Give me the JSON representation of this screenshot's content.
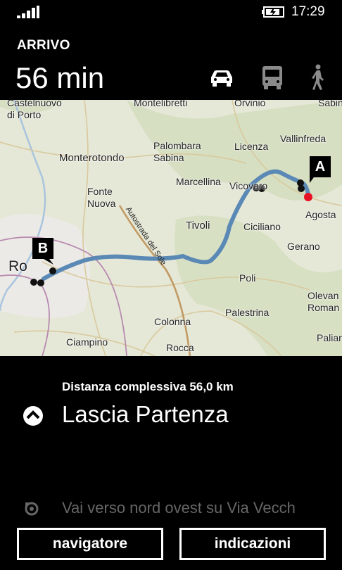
{
  "status_bar": {
    "time": "17:29",
    "signal": "signal-bars-icon",
    "battery": "battery-charging-icon"
  },
  "header": {
    "label": "ARRIVO",
    "duration": "56 min"
  },
  "transport_modes": [
    {
      "name": "car-icon",
      "selected": true
    },
    {
      "name": "bus-icon",
      "selected": false
    },
    {
      "name": "walk-icon",
      "selected": false
    }
  ],
  "map": {
    "places": [
      {
        "key": "castelnuovo",
        "text": "Castelnuovo\ndi Porto"
      },
      {
        "key": "montelibretti",
        "text": "Montelibretti"
      },
      {
        "key": "orvinio",
        "text": "Orvinio"
      },
      {
        "key": "sabin",
        "text": "Sabin"
      },
      {
        "key": "vallinfreda",
        "text": "Vallinfreda"
      },
      {
        "key": "palombara",
        "text": "Palombara\nSabina"
      },
      {
        "key": "licenza",
        "text": "Licenza"
      },
      {
        "key": "monterotondo",
        "text": "Monterotondo"
      },
      {
        "key": "marcellina",
        "text": "Marcellina"
      },
      {
        "key": "vicovaro",
        "text": "Vicovaro"
      },
      {
        "key": "fonte",
        "text": "Fonte\nNuova"
      },
      {
        "key": "agosta",
        "text": "Agosta"
      },
      {
        "key": "tivoli",
        "text": "Tivoli"
      },
      {
        "key": "ciciliano",
        "text": "Ciciliano"
      },
      {
        "key": "gerano",
        "text": "Gerano"
      },
      {
        "key": "roma",
        "text": "Ro"
      },
      {
        "key": "poli",
        "text": "Poli"
      },
      {
        "key": "olevano",
        "text": "Olevan\nRoman"
      },
      {
        "key": "palestrina",
        "text": "Palestrina"
      },
      {
        "key": "colonna",
        "text": "Colonna"
      },
      {
        "key": "paliar",
        "text": "Paliar"
      },
      {
        "key": "ciampino",
        "text": "Ciampino"
      },
      {
        "key": "rocca",
        "text": "Rocca\nPriora"
      }
    ],
    "road_label": "Autostrada del Sole",
    "pin_a": "A",
    "pin_b": "B",
    "colors": {
      "route": "#5b89b5",
      "origin": "#e81123"
    }
  },
  "directions": {
    "summary": "Distanza complessiva 56,0 km",
    "current_step": "Lascia Partenza",
    "next_step": "Vai verso nord ovest su Via Vecch"
  },
  "buttons": {
    "navigator": "navigatore",
    "directions": "indicazioni"
  }
}
